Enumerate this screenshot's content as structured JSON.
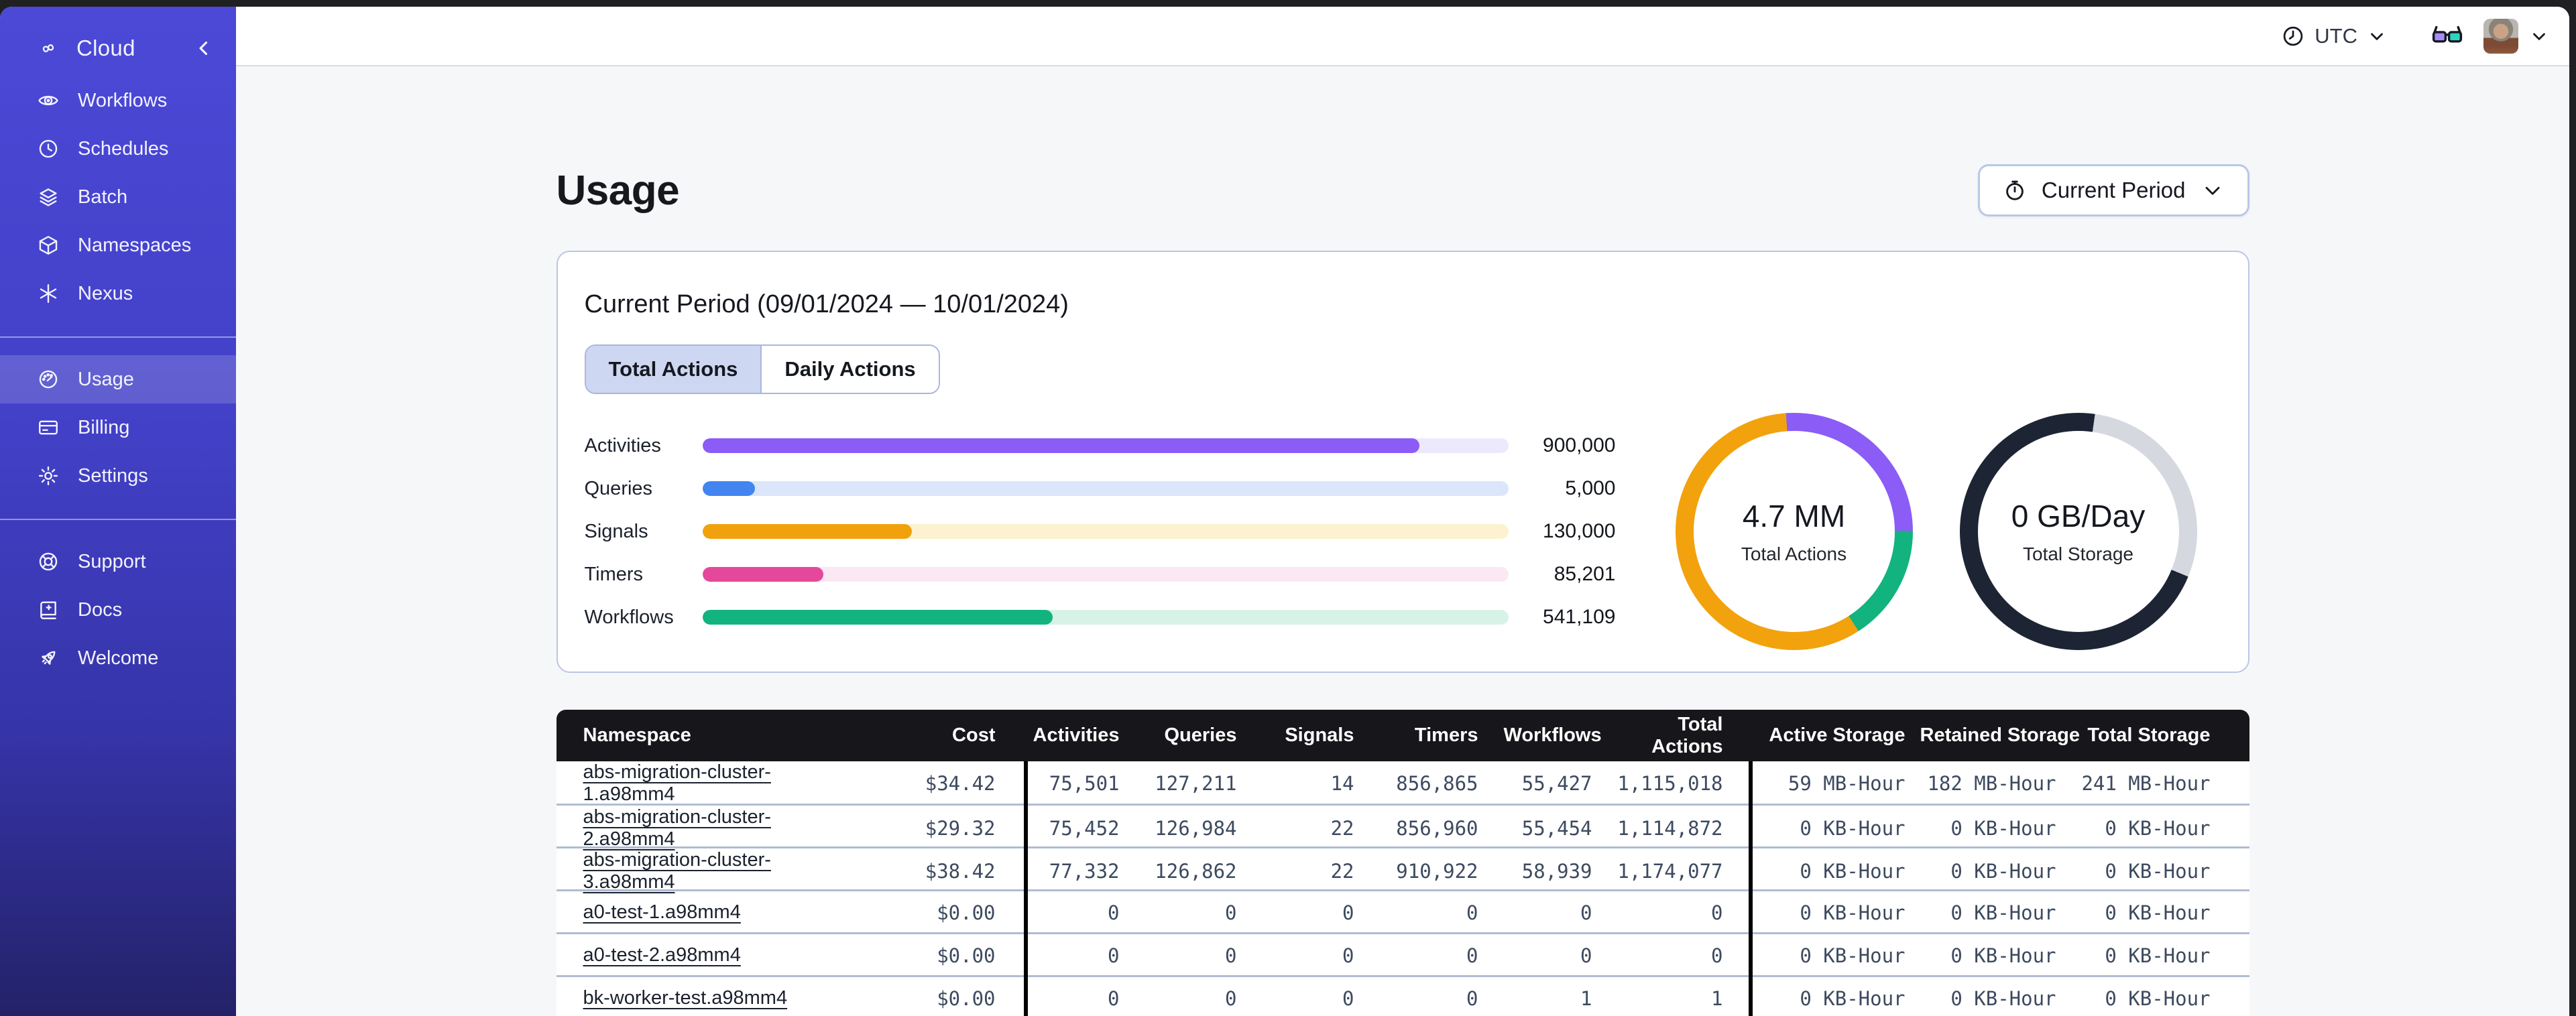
{
  "sidebar": {
    "brand": {
      "label": "Cloud"
    },
    "sections": [
      {
        "items": [
          {
            "icon": "workflows-icon",
            "label": "Workflows"
          },
          {
            "icon": "schedules-icon",
            "label": "Schedules"
          },
          {
            "icon": "batch-icon",
            "label": "Batch"
          },
          {
            "icon": "namespaces-icon",
            "label": "Namespaces"
          },
          {
            "icon": "nexus-icon",
            "label": "Nexus"
          }
        ]
      },
      {
        "items": [
          {
            "icon": "usage-icon",
            "label": "Usage",
            "active": true
          },
          {
            "icon": "billing-icon",
            "label": "Billing"
          },
          {
            "icon": "settings-icon",
            "label": "Settings"
          }
        ]
      },
      {
        "items": [
          {
            "icon": "support-icon",
            "label": "Support"
          },
          {
            "icon": "docs-icon",
            "label": "Docs"
          },
          {
            "icon": "welcome-icon",
            "label": "Welcome"
          }
        ]
      }
    ]
  },
  "topbar": {
    "timezone": "UTC"
  },
  "main": {
    "title": "Usage",
    "period_button": {
      "label": "Current Period"
    },
    "card": {
      "title": "Current Period (09/01/2024 — 10/01/2024)",
      "tabs": [
        {
          "label": "Total Actions",
          "active": true
        },
        {
          "label": "Daily Actions",
          "active": false
        }
      ]
    }
  },
  "chart_data": [
    {
      "type": "bar",
      "title": "Current Period (09/01/2024 — 10/01/2024)",
      "orientation": "horizontal",
      "categories": [
        "Activities",
        "Queries",
        "Signals",
        "Timers",
        "Workflows"
      ],
      "values": [
        900000,
        5000,
        130000,
        85201,
        541109
      ],
      "display_values": [
        "900,000",
        "5,000",
        "130,000",
        "85,201",
        "541,109"
      ],
      "fill_pct": [
        89,
        6.5,
        26,
        15,
        43.5
      ],
      "colors": [
        "#8B5CF6",
        "#4285F0",
        "#F0A10C",
        "#E5489B",
        "#12B37E"
      ],
      "track_colors": [
        "#EDE9FD",
        "#DBE6FB",
        "#FCF2CF",
        "#FCE7F5",
        "#D7F3E7"
      ]
    },
    {
      "type": "pie",
      "center_value": "4.7 MM",
      "center_label": "Total Actions",
      "start_deg": 356,
      "segments": [
        {
          "name": "purple",
          "pct": 26,
          "color": "#8B5CF6"
        },
        {
          "name": "green",
          "pct": 16,
          "color": "#12B37E"
        },
        {
          "name": "orange",
          "pct": 58,
          "color": "#F2A20D"
        }
      ]
    },
    {
      "type": "pie",
      "center_value": "0 GB/Day",
      "center_label": "Total Storage",
      "start_deg": 8,
      "segments": [
        {
          "name": "light-gray",
          "pct": 29,
          "color": "#D5D8DE"
        },
        {
          "name": "dark-navy",
          "pct": 71,
          "color": "#1D2434"
        }
      ]
    }
  ],
  "table": {
    "columns": [
      "Namespace",
      "Cost",
      "Activities",
      "Queries",
      "Signals",
      "Timers",
      "Workflows",
      "Total Actions",
      "Active Storage",
      "Retained Storage",
      "Total Storage"
    ],
    "rows": [
      {
        "cells": [
          "abs-migration-cluster-1.a98mm4",
          "$34.42",
          "75,501",
          "127,211",
          "14",
          "856,865",
          "55,427",
          "1,115,018",
          "59 MB-Hour",
          "182 MB-Hour",
          "241 MB-Hour"
        ]
      },
      {
        "cells": [
          "abs-migration-cluster-2.a98mm4",
          "$29.32",
          "75,452",
          "126,984",
          "22",
          "856,960",
          "55,454",
          "1,114,872",
          "0 KB-Hour",
          "0 KB-Hour",
          "0 KB-Hour"
        ]
      },
      {
        "cells": [
          "abs-migration-cluster-3.a98mm4",
          "$38.42",
          "77,332",
          "126,862",
          "22",
          "910,922",
          "58,939",
          "1,174,077",
          "0 KB-Hour",
          "0 KB-Hour",
          "0 KB-Hour"
        ]
      },
      {
        "cells": [
          "a0-test-1.a98mm4",
          "$0.00",
          "0",
          "0",
          "0",
          "0",
          "0",
          "0",
          "0 KB-Hour",
          "0 KB-Hour",
          "0 KB-Hour"
        ]
      },
      {
        "cells": [
          "a0-test-2.a98mm4",
          "$0.00",
          "0",
          "0",
          "0",
          "0",
          "0",
          "0",
          "0 KB-Hour",
          "0 KB-Hour",
          "0 KB-Hour"
        ]
      },
      {
        "cells": [
          "bk-worker-test.a98mm4",
          "$0.00",
          "0",
          "0",
          "0",
          "0",
          "1",
          "1",
          "0 KB-Hour",
          "0 KB-Hour",
          "0 KB-Hour"
        ]
      }
    ]
  }
}
